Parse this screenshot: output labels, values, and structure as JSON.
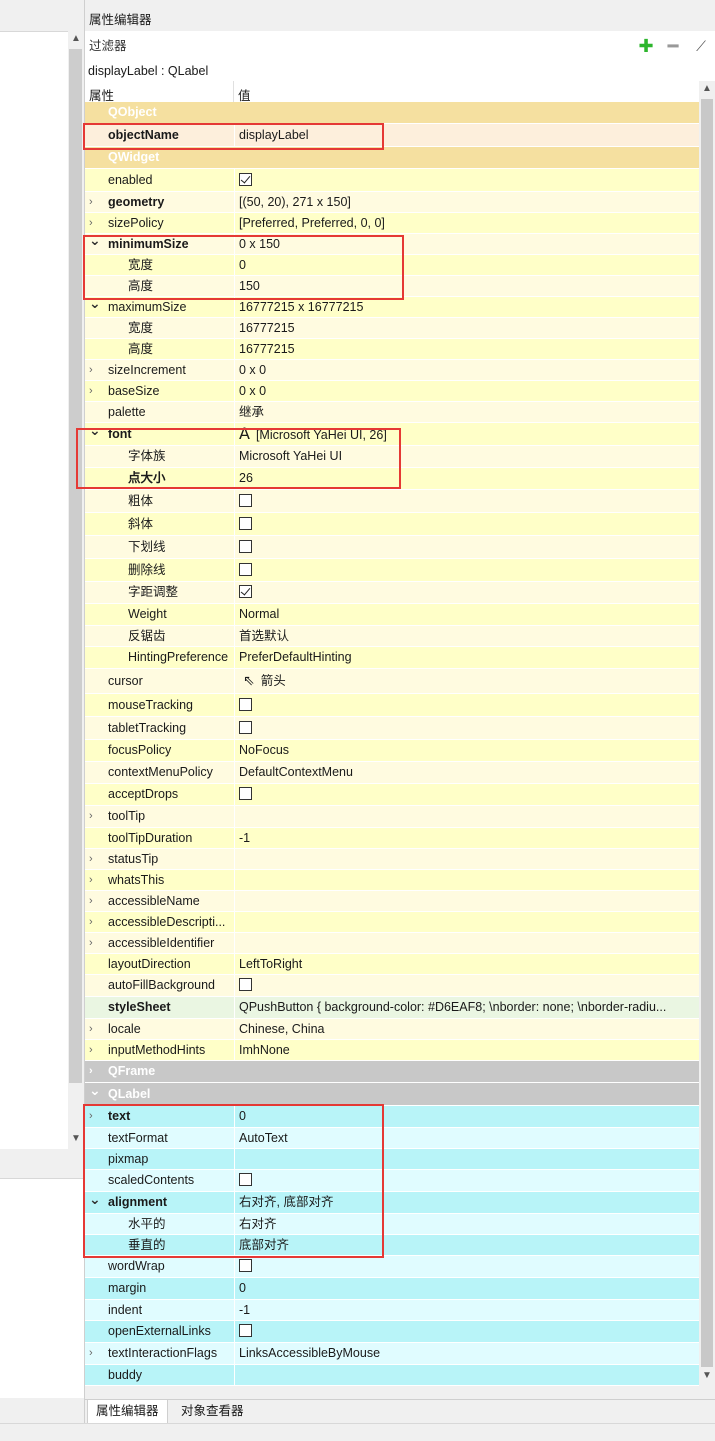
{
  "panel": {
    "title": "属性编辑器",
    "filter_placeholder": "过滤器",
    "object_line": "displayLabel : QLabel",
    "col_property": "属性",
    "col_value": "值",
    "tabs": [
      "属性编辑器",
      "对象查看器"
    ]
  },
  "colors": {
    "group_qobject": "#f5e0a0",
    "yellow_a": "#ffffc8",
    "yellow_b": "#fffbe0",
    "selected": "#fdefdc",
    "qframe": "#c8c8c8",
    "cyan_a": "#b8f4f8",
    "cyan_b": "#e0fcff",
    "highlight": "#e53935"
  },
  "rows": [
    {
      "name": "QObject",
      "type": "group",
      "tone": "qobject_group"
    },
    {
      "name": "objectName",
      "value": "displayLabel",
      "bold": true,
      "tone": "selected",
      "level": 0
    },
    {
      "name": "QWidget",
      "type": "group",
      "tone": "qwidget_group"
    },
    {
      "name": "enabled",
      "check": true,
      "tone": "a",
      "level": 0
    },
    {
      "name": "geometry",
      "value": "[(50, 20), 271 x 150]",
      "bold": true,
      "expander": "closed",
      "tone": "b",
      "level": 0
    },
    {
      "name": "sizePolicy",
      "value": "[Preferred, Preferred, 0, 0]",
      "expander": "closed",
      "tone": "a",
      "level": 0
    },
    {
      "name": "minimumSize",
      "value": "0 x 150",
      "bold": true,
      "expander": "open",
      "tone": "b",
      "level": 0
    },
    {
      "name": "宽度",
      "value": "0",
      "tone": "a",
      "level": 1
    },
    {
      "name": "高度",
      "value": "150",
      "tone": "b",
      "level": 1
    },
    {
      "name": "maximumSize",
      "value": "16777215 x 16777215",
      "expander": "open",
      "tone": "a",
      "level": 0
    },
    {
      "name": "宽度",
      "value": "16777215",
      "tone": "b",
      "level": 1
    },
    {
      "name": "高度",
      "value": "16777215",
      "tone": "a",
      "level": 1
    },
    {
      "name": "sizeIncrement",
      "value": "0 x 0",
      "expander": "closed",
      "tone": "b",
      "level": 0
    },
    {
      "name": "baseSize",
      "value": "0 x 0",
      "expander": "closed",
      "tone": "a",
      "level": 0
    },
    {
      "name": "palette",
      "value": "继承",
      "tone": "b",
      "level": 0
    },
    {
      "name": "font",
      "value": "[Microsoft YaHei UI, 26]",
      "icon": "A",
      "bold": true,
      "expander": "open",
      "tone": "a",
      "level": 0
    },
    {
      "name": "字体族",
      "value": "Microsoft YaHei UI",
      "tone": "b",
      "level": 1
    },
    {
      "name": "点大小",
      "value": "26",
      "bold": true,
      "tone": "a",
      "level": 1
    },
    {
      "name": "粗体",
      "check": false,
      "tone": "b",
      "level": 1
    },
    {
      "name": "斜体",
      "check": false,
      "tone": "a",
      "level": 1
    },
    {
      "name": "下划线",
      "check": false,
      "tone": "b",
      "level": 1
    },
    {
      "name": "删除线",
      "check": false,
      "tone": "a",
      "level": 1
    },
    {
      "name": "字距调整",
      "check": true,
      "tone": "b",
      "level": 1
    },
    {
      "name": "Weight",
      "value": "Normal",
      "tone": "a",
      "level": 1
    },
    {
      "name": "反锯齿",
      "value": "首选默认",
      "tone": "b",
      "level": 1
    },
    {
      "name": "HintingPreference",
      "value": "PreferDefaultHinting",
      "tone": "a",
      "level": 1
    },
    {
      "name": "cursor",
      "value": "箭头",
      "icon": "cursor",
      "tone": "b",
      "level": 0
    },
    {
      "name": "mouseTracking",
      "check": false,
      "tone": "a",
      "level": 0
    },
    {
      "name": "tabletTracking",
      "check": false,
      "tone": "b",
      "level": 0
    },
    {
      "name": "focusPolicy",
      "value": "NoFocus",
      "tone": "a",
      "level": 0
    },
    {
      "name": "contextMenuPolicy",
      "value": "DefaultContextMenu",
      "tone": "b",
      "level": 0
    },
    {
      "name": "acceptDrops",
      "check": false,
      "tone": "a",
      "level": 0
    },
    {
      "name": "toolTip",
      "value": "",
      "expander": "closed",
      "tone": "b",
      "level": 0
    },
    {
      "name": "toolTipDuration",
      "value": "-1",
      "tone": "a",
      "level": 0
    },
    {
      "name": "statusTip",
      "value": "",
      "expander": "closed",
      "tone": "b",
      "level": 0
    },
    {
      "name": "whatsThis",
      "value": "",
      "expander": "closed",
      "tone": "a",
      "level": 0
    },
    {
      "name": "accessibleName",
      "value": "",
      "expander": "closed",
      "tone": "b",
      "level": 0
    },
    {
      "name": "accessibleDescripti...",
      "value": "",
      "expander": "closed",
      "tone": "a",
      "level": 0
    },
    {
      "name": "accessibleIdentifier",
      "value": "",
      "expander": "closed",
      "tone": "b",
      "level": 0
    },
    {
      "name": "layoutDirection",
      "value": "LeftToRight",
      "tone": "a",
      "level": 0
    },
    {
      "name": "autoFillBackground",
      "check": false,
      "tone": "b",
      "level": 0
    },
    {
      "name": "styleSheet",
      "value": "QPushButton { background-color: #D6EAF8; \\nborder: none; \\nborder-radiu...",
      "bold": true,
      "tone": "sheet",
      "level": 0
    },
    {
      "name": "locale",
      "value": "Chinese, China",
      "expander": "closed",
      "tone": "b",
      "level": 0
    },
    {
      "name": "inputMethodHints",
      "value": "ImhNone",
      "expander": "closed",
      "tone": "a",
      "level": 0
    },
    {
      "name": "QFrame",
      "type": "group",
      "tone": "qframe",
      "expander": "closed"
    },
    {
      "name": "QLabel",
      "type": "group",
      "tone": "qlabel_group",
      "expander": "open"
    },
    {
      "name": "text",
      "value": "0",
      "bold": true,
      "expander": "closed",
      "tone": "ca",
      "level": 0
    },
    {
      "name": "textFormat",
      "value": "AutoText",
      "tone": "cb",
      "level": 0
    },
    {
      "name": "pixmap",
      "value": "",
      "tone": "ca",
      "level": 0
    },
    {
      "name": "scaledContents",
      "check": false,
      "tone": "cb",
      "level": 0
    },
    {
      "name": "alignment",
      "value": "右对齐, 底部对齐",
      "bold": true,
      "expander": "open",
      "tone": "ca",
      "level": 0
    },
    {
      "name": "水平的",
      "value": "右对齐",
      "tone": "cb",
      "level": 1
    },
    {
      "name": "垂直的",
      "value": "底部对齐",
      "tone": "ca",
      "level": 1
    },
    {
      "name": "wordWrap",
      "check": false,
      "tone": "cb",
      "level": 0
    },
    {
      "name": "margin",
      "value": "0",
      "tone": "ca",
      "level": 0
    },
    {
      "name": "indent",
      "value": "-1",
      "tone": "cb",
      "level": 0
    },
    {
      "name": "openExternalLinks",
      "check": false,
      "tone": "ca",
      "level": 0
    },
    {
      "name": "textInteractionFlags",
      "value": "LinksAccessibleByMouse",
      "expander": "closed",
      "tone": "cb",
      "level": 0
    },
    {
      "name": "buddy",
      "value": "",
      "tone": "ca",
      "level": 0
    }
  ]
}
